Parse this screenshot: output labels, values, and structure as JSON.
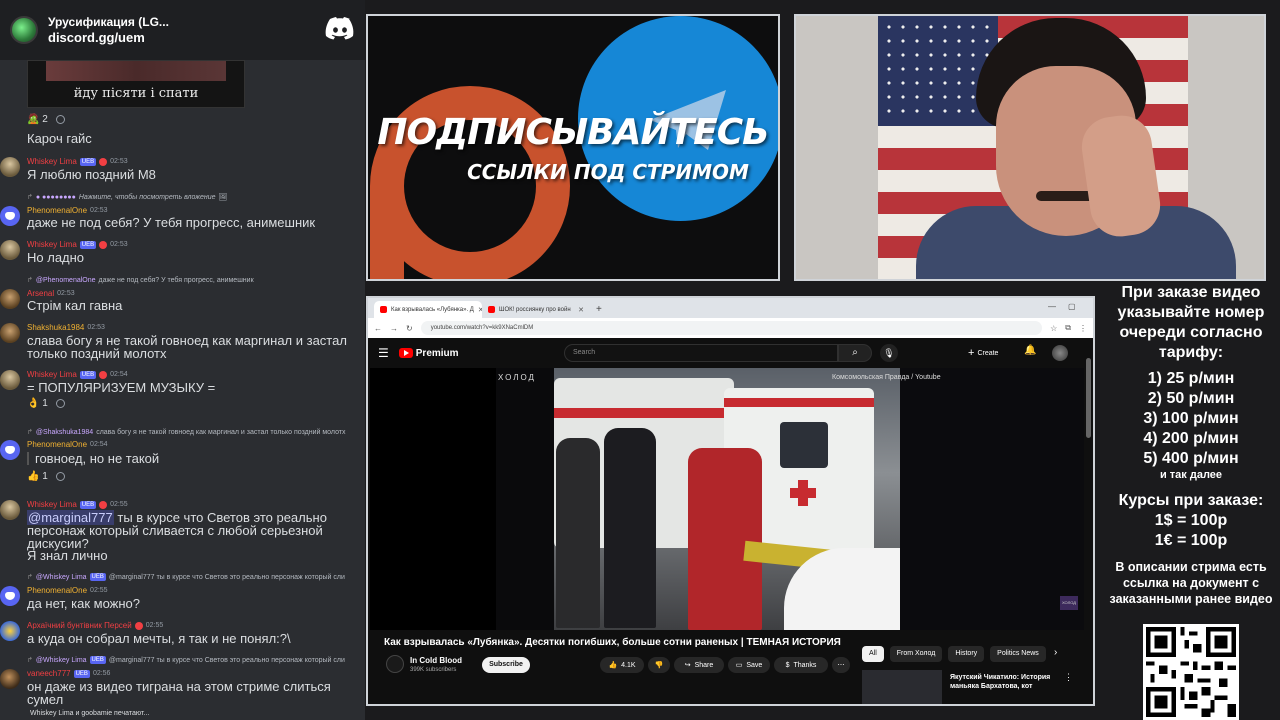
{
  "discord": {
    "server_name": "Урусификация (LG...",
    "server_link": "discord.gg/uem",
    "embed_caption": "йду пісяти і спати",
    "embed_reactions": "2",
    "messages": [
      {
        "text": "Кароч гайс"
      },
      {
        "user": "Whiskey Lima",
        "badge": "UEB",
        "time": "02:53",
        "text": "Я люблю поздний М8"
      },
      {
        "reply_text": "Нажмите, чтобы посмотреть вложение",
        "user": "PhenomenalOne",
        "time": "02:53",
        "text": "даже не под себя? У тебя прогресс, анимешник"
      },
      {
        "user": "Whiskey Lima",
        "badge": "UEB",
        "time": "02:53",
        "text": "Но ладно"
      },
      {
        "reply_user": "@PhenomenalOne",
        "reply_text": "даже не под себя? У тебя прогресс, анимешник",
        "user": "Arsenal",
        "time": "02:53",
        "text": "Стрім кал гавна"
      },
      {
        "user": "Shakshuka1984",
        "time": "02:53",
        "text": "слава богу я не такой говноед как маргинал и застал только поздний молотх"
      },
      {
        "user": "Whiskey Lima",
        "badge": "UEB",
        "time": "02:54",
        "text": "= ПОПУЛЯРИЗУЕМ МУЗЫКУ =",
        "reaction": "1"
      },
      {
        "reply_user": "@Shakshuka1984",
        "reply_text": "слава богу я не такой говноед как маргинал и застал только поздний молотх",
        "user": "PhenomenalOne",
        "time": "02:54",
        "text": "говноед, но не такой",
        "reaction": "1"
      },
      {
        "user": "Whiskey Lima",
        "badge": "UEB",
        "time": "02:55",
        "mention": "@marginal777",
        "text": " ты в курсе что Светов это реально персонаж который сливается с любой серьезной дискусии?",
        "text2": "Я знал лично"
      },
      {
        "reply_user": "@Whiskey Lima",
        "reply_badge": "UEB",
        "reply_text": "@marginal777 ты в курсе что Светов это реально персонаж который сли",
        "user": "PhenomenalOne",
        "time": "02:55",
        "text": "да нет, как можно?"
      },
      {
        "user": "Архаїчний бунтівник Персей",
        "time": "02:55",
        "text": "а куда он собрал мечты, я так и не понял:?\\"
      },
      {
        "reply_user": "@Whiskey Lima",
        "reply_badge": "UEB",
        "reply_text": "@marginal777 ты в курсе что Светов это реально персонаж который сли",
        "user": "vaneech777",
        "badge": "UEB",
        "time": "02:56",
        "text": "он даже из видео тиграна на этом стриме слиться сумел"
      }
    ],
    "typing": "Whiskey Lima и goobamie печатают..."
  },
  "promo": {
    "title": "ПОДПИСЫВАЙТЕСЬ",
    "subtitle": "ССЫЛКИ ПОД СТРИМОМ"
  },
  "browser": {
    "tabs": [
      {
        "label": "Как взрывалась «Лубянка». Д"
      },
      {
        "label": "ШОК! россиянку про войн"
      }
    ],
    "url": "youtube.com/watch?v=kk9XNaCmlDM",
    "youtube": {
      "logo": "Premium",
      "search_placeholder": "Search",
      "create_label": "Create",
      "player_brand": "ХОЛОД",
      "player_credit": "Комсомольская Правда / Youtube",
      "corner_badge": "ХОЛОД",
      "video_title": "Как взрывалась «Лубянка». Десятки погибших, больше сотни раненых | ТЕМНАЯ ИСТОРИЯ",
      "channel_name": "In Cold Blood",
      "channel_subs": "399K subscribers",
      "subscribe_label": "Subscribe",
      "like_count": "4.1K",
      "share_label": "Share",
      "save_label": "Save",
      "thanks_label": "Thanks",
      "chips": [
        "All",
        "From Холод",
        "History",
        "Politics News"
      ],
      "rec_title": "Якутский Чикатило: История маньяка Бархатова, кот"
    }
  },
  "info": {
    "order_text": "При заказе видео указывайте номер очереди согласно тарифу:",
    "tariffs": [
      "1) 25 р/мин",
      "2) 50 р/мин",
      "3) 100 р/мин",
      "4) 200 р/мин",
      "5) 400 р/мин"
    ],
    "tariff_more": "и так далее",
    "courses_title": "Курсы при заказе:",
    "courses": [
      "1$ = 100р",
      "1€ = 100р"
    ],
    "desc_note": "В описании стрима есть ссылка на документ с заказанными ранее видео"
  },
  "colors": {
    "discord_bg": "#2b2d31",
    "discord_blurple": "#5865f2",
    "username_red": "#f23f43",
    "youtube_red": "#ff0000",
    "promo_blue": "#1687d6",
    "promo_red": "#c8522d"
  },
  "icons": [
    "discord-logo-icon",
    "hamburger-icon",
    "search-icon",
    "mic-icon",
    "bell-icon",
    "like-icon",
    "dislike-icon",
    "share-icon",
    "save-icon",
    "thanks-icon",
    "more-icon",
    "qr-code-icon"
  ]
}
